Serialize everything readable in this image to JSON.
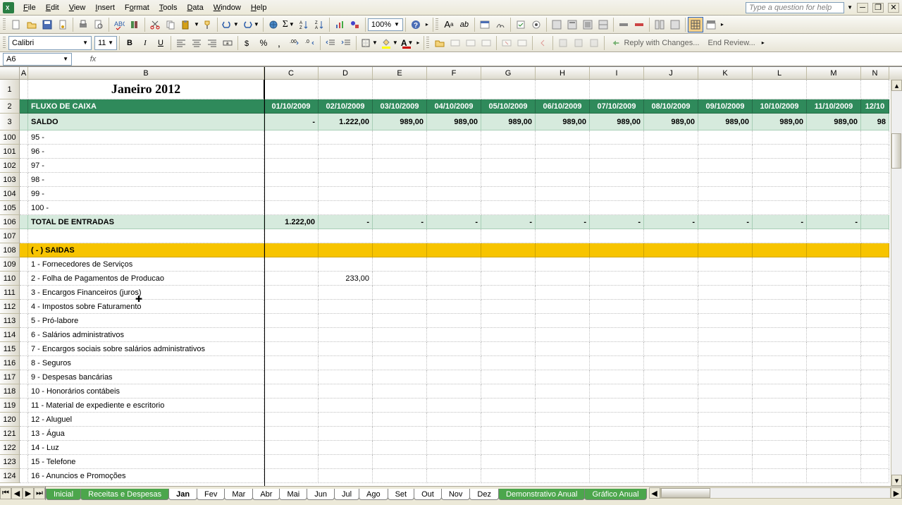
{
  "menu": {
    "file": "File",
    "edit": "Edit",
    "view": "View",
    "insert": "Insert",
    "format": "Format",
    "tools": "Tools",
    "data": "Data",
    "window": "Window",
    "help": "Help"
  },
  "help_placeholder": "Type a question for help",
  "toolbar": {
    "zoom": "100%",
    "reply": "Reply with Changes...",
    "end_review": "End Review..."
  },
  "format": {
    "font": "Calibri",
    "size": "11"
  },
  "namebox": "A6",
  "columns": [
    "A",
    "B",
    "C",
    "D",
    "E",
    "F",
    "G",
    "H",
    "I",
    "J",
    "K",
    "L",
    "M",
    "N"
  ],
  "sheet": {
    "title": "Janeiro 2012",
    "header_label": "FLUXO DE CAIXA",
    "dates": [
      "01/10/2009",
      "02/10/2009",
      "03/10/2009",
      "04/10/2009",
      "05/10/2009",
      "06/10/2009",
      "07/10/2009",
      "08/10/2009",
      "09/10/2009",
      "10/10/2009",
      "11/10/2009",
      "12/10"
    ],
    "saldo_label": "SALDO",
    "saldo_values": [
      "-",
      "1.222,00",
      "989,00",
      "989,00",
      "989,00",
      "989,00",
      "989,00",
      "989,00",
      "989,00",
      "989,00",
      "989,00",
      "98"
    ],
    "rows_95_100": [
      "95 -",
      "96 -",
      "97 -",
      "98 -",
      "99 -",
      "100 -"
    ],
    "total_entradas_label": "TOTAL DE ENTRADAS",
    "total_entradas_values": [
      "1.222,00",
      "-",
      "-",
      "-",
      "-",
      "-",
      "-",
      "-",
      "-",
      "-",
      "-",
      ""
    ],
    "saidas_label": "( - ) SAIDAS",
    "saidas_items": [
      "1 - Fornecedores de Serviços",
      "2 - Folha de Pagamentos de Producao",
      "3 - Encargos Financeiros (juros)",
      "4 - Impostos sobre Faturamento",
      "5 - Pró-labore",
      "6 - Salários administrativos",
      "7 - Encargos sociais sobre salários administrativos",
      "8 - Seguros",
      "9 - Despesas bancárias",
      "10 - Honorários contábeis",
      "11 - Material de expediente e escritorio",
      "12 - Aluguel",
      "13 - Água",
      "14 - Luz",
      "15 - Telefone",
      "16 - Anuncios e Promoções"
    ],
    "folha_value": "233,00",
    "row_nums_top": [
      "1",
      "2",
      "3"
    ],
    "row_nums_data": [
      "100",
      "101",
      "102",
      "103",
      "104",
      "105",
      "106",
      "107",
      "108",
      "109",
      "110",
      "111",
      "112",
      "113",
      "114",
      "115",
      "116",
      "117",
      "118",
      "119",
      "120",
      "121",
      "122",
      "123",
      "124"
    ]
  },
  "tabs": {
    "inicial": "Inicial",
    "receitas": "Receitas e Despesas",
    "months": [
      "Jan",
      "Fev",
      "Mar",
      "Abr",
      "Mai",
      "Jun",
      "Jul",
      "Ago",
      "Set",
      "Out",
      "Nov",
      "Dez"
    ],
    "demo": "Demonstrativo Anual",
    "grafico": "Gráfico Anual"
  }
}
